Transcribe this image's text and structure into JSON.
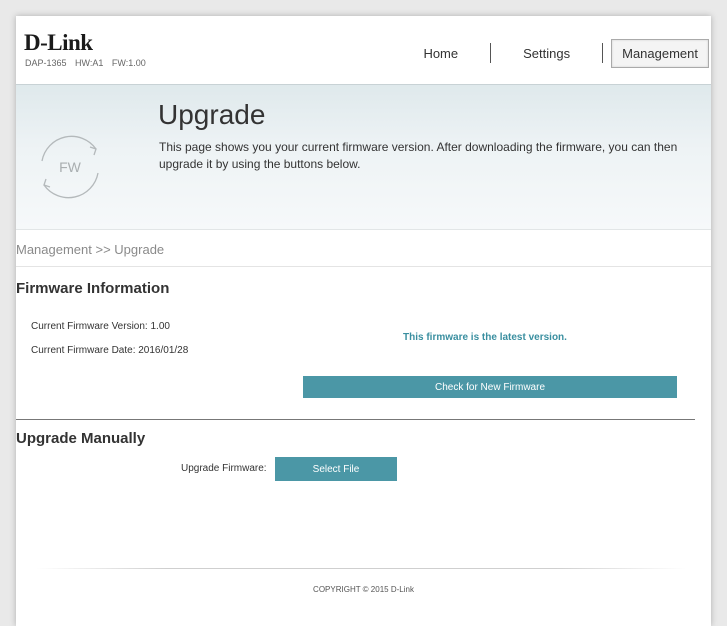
{
  "header": {
    "logo": "D-Link",
    "model": "DAP-1365",
    "hw": "HW:A1",
    "fw": "FW:1.00",
    "nav": {
      "home": "Home",
      "settings": "Settings",
      "management": "Management"
    }
  },
  "banner": {
    "icon_label": "FW",
    "title": "Upgrade",
    "description": "This page shows you your current firmware version. After downloading the firmware, you can then upgrade it by using the buttons below."
  },
  "breadcrumb": "Management >> Upgrade",
  "firmware_info": {
    "title": "Firmware Information",
    "current_version": "Current Firmware Version: 1.00",
    "current_date": "Current Firmware Date: 2016/01/28",
    "status_message": "This firmware is the latest version.",
    "check_button": "Check for New Firmware"
  },
  "upgrade_manually": {
    "title": "Upgrade Manually",
    "label": "Upgrade Firmware:",
    "select_button": "Select File"
  },
  "footer": {
    "copyright": "COPYRIGHT © 2015 D-Link"
  },
  "colors": {
    "accent": "#4b97a6",
    "status_text": "#3a8fa0"
  },
  "icons": [
    "firmware-refresh-icon"
  ]
}
